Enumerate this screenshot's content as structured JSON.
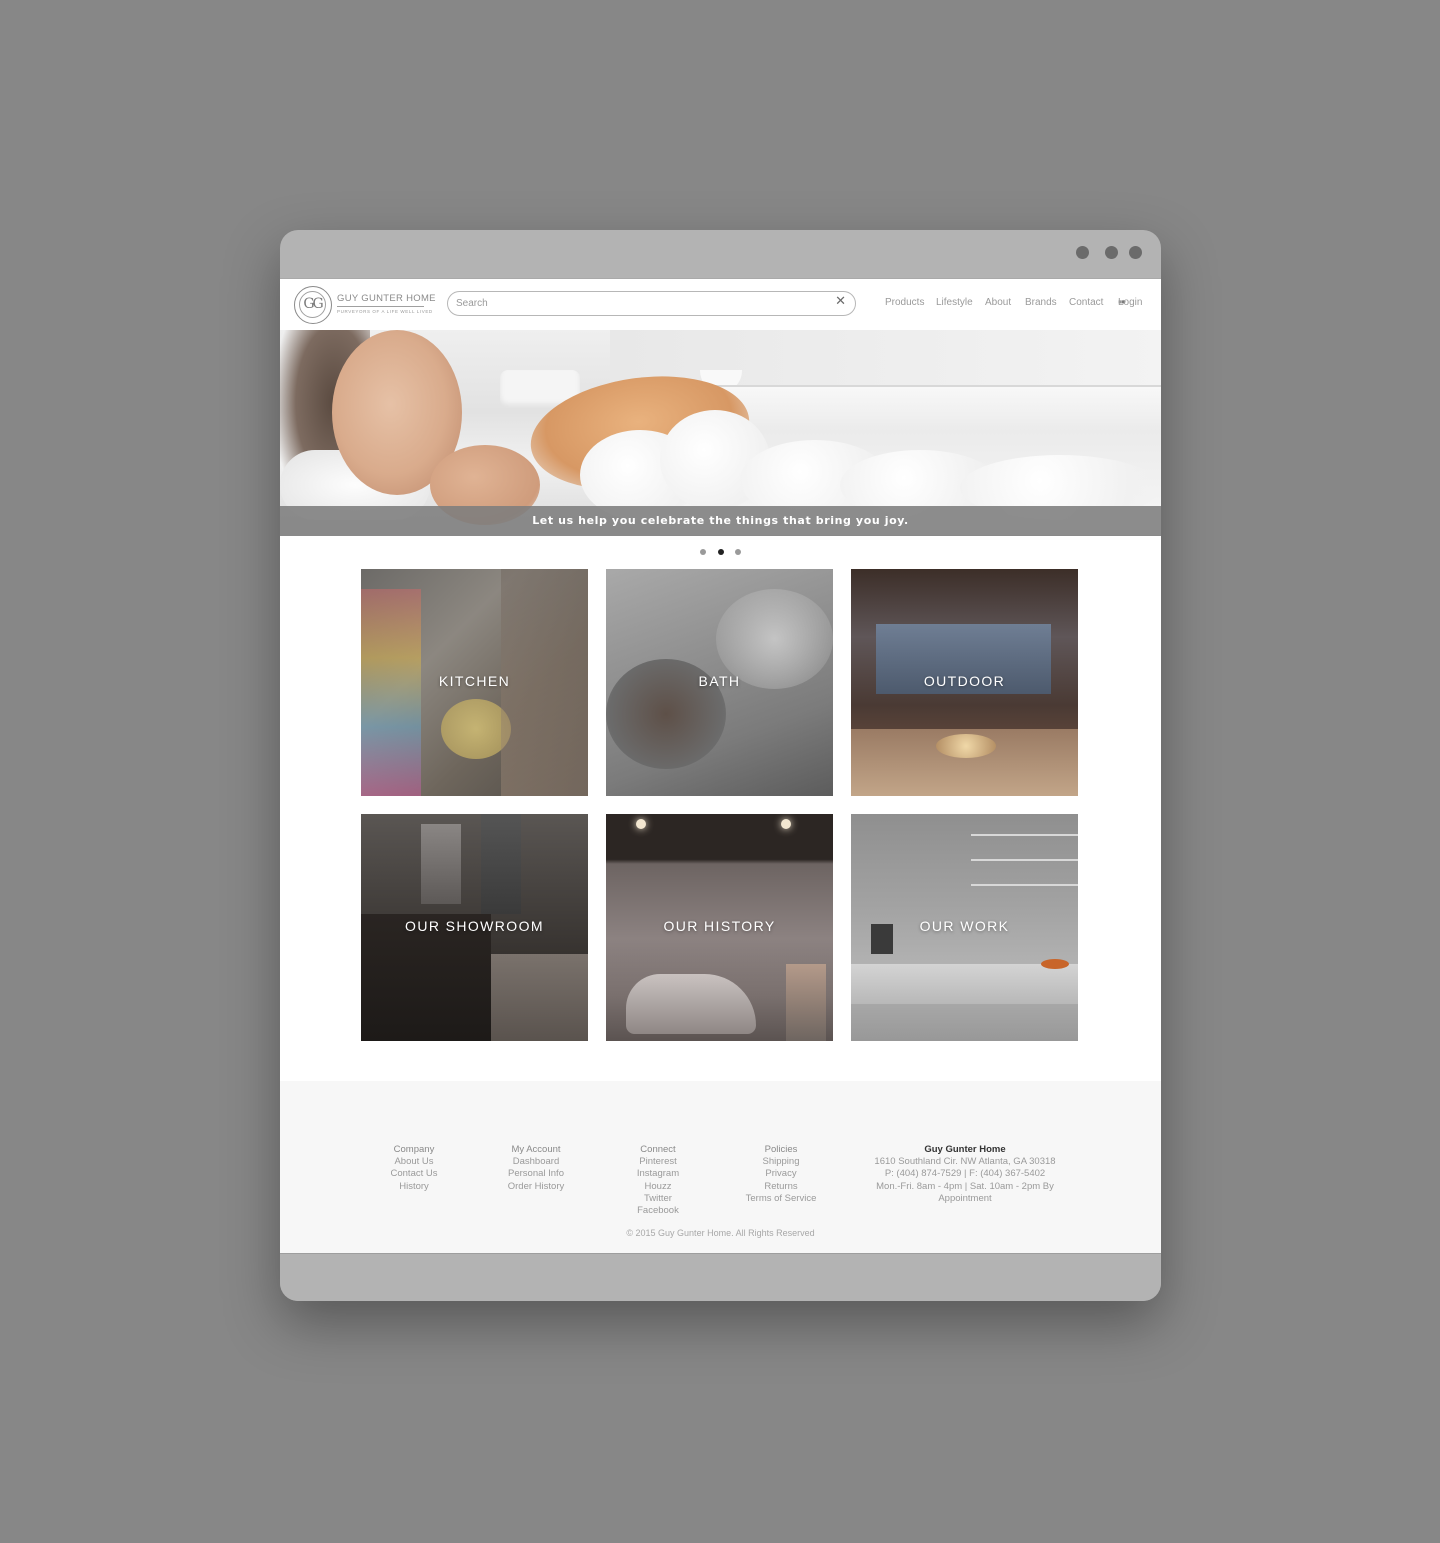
{
  "window": {
    "controls": [
      "minimize",
      "maximize",
      "close"
    ]
  },
  "header": {
    "logo": {
      "name": "GUY GUNTER HOME",
      "tagline": "PURVEYORS OF A LIFE WELL LIVED",
      "monogram": "GG"
    },
    "search": {
      "placeholder": "Search",
      "value": "",
      "clear_icon": "✕"
    },
    "nav": [
      {
        "label": "Products"
      },
      {
        "label": "Lifestyle"
      },
      {
        "label": "About"
      },
      {
        "label": "Brands"
      },
      {
        "label": "Contact"
      },
      {
        "label": "Login",
        "icon": "login-icon"
      }
    ]
  },
  "hero": {
    "caption": "Let us help you celebrate the things that bring you joy.",
    "carousel": {
      "count": 3,
      "active_index": 1
    }
  },
  "tiles": [
    {
      "label": "KITCHEN"
    },
    {
      "label": "BATH"
    },
    {
      "label": "OUTDOOR"
    },
    {
      "label": "OUR SHOWROOM"
    },
    {
      "label": "OUR HISTORY"
    },
    {
      "label": "OUR WORK"
    }
  ],
  "footer": {
    "columns": [
      {
        "heading": "Company",
        "links": [
          "About Us",
          "Contact Us",
          "History"
        ]
      },
      {
        "heading": "My Account",
        "links": [
          "Dashboard",
          "Personal Info",
          "Order History"
        ]
      },
      {
        "heading": "Connect",
        "links": [
          "Pinterest",
          "Instagram",
          "Houzz",
          "Twitter",
          "Facebook"
        ]
      },
      {
        "heading": "Policies",
        "links": [
          "Shipping",
          "Privacy",
          "Returns",
          "Terms of Service"
        ]
      }
    ],
    "contact": {
      "name": "Guy Gunter Home",
      "address": "1610 Southland Cir. NW Atlanta, GA 30318",
      "phone": "P: (404) 874-7529 | F: (404) 367-5402",
      "hours_line1": "Mon.-Fri. 8am - 4pm | Sat. 10am - 2pm By",
      "hours_line2": "Appointment"
    },
    "copyright": "© 2015 Guy Gunter Home. All Rights Reserved"
  },
  "colors": {
    "background": "#878787",
    "frame": "#b3b3b3",
    "caption_bar": "#7d7d7d",
    "footer_bg": "#f7f7f7",
    "active_dot": "#222222"
  }
}
